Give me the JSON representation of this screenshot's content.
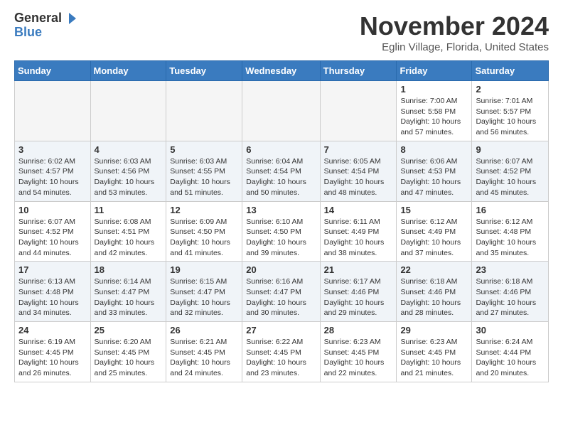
{
  "header": {
    "logo_line1": "General",
    "logo_line2": "Blue",
    "month": "November 2024",
    "location": "Eglin Village, Florida, United States"
  },
  "weekdays": [
    "Sunday",
    "Monday",
    "Tuesday",
    "Wednesday",
    "Thursday",
    "Friday",
    "Saturday"
  ],
  "weeks": [
    [
      {
        "day": "",
        "info": ""
      },
      {
        "day": "",
        "info": ""
      },
      {
        "day": "",
        "info": ""
      },
      {
        "day": "",
        "info": ""
      },
      {
        "day": "",
        "info": ""
      },
      {
        "day": "1",
        "info": "Sunrise: 7:00 AM\nSunset: 5:58 PM\nDaylight: 10 hours\nand 57 minutes."
      },
      {
        "day": "2",
        "info": "Sunrise: 7:01 AM\nSunset: 5:57 PM\nDaylight: 10 hours\nand 56 minutes."
      }
    ],
    [
      {
        "day": "3",
        "info": "Sunrise: 6:02 AM\nSunset: 4:57 PM\nDaylight: 10 hours\nand 54 minutes."
      },
      {
        "day": "4",
        "info": "Sunrise: 6:03 AM\nSunset: 4:56 PM\nDaylight: 10 hours\nand 53 minutes."
      },
      {
        "day": "5",
        "info": "Sunrise: 6:03 AM\nSunset: 4:55 PM\nDaylight: 10 hours\nand 51 minutes."
      },
      {
        "day": "6",
        "info": "Sunrise: 6:04 AM\nSunset: 4:54 PM\nDaylight: 10 hours\nand 50 minutes."
      },
      {
        "day": "7",
        "info": "Sunrise: 6:05 AM\nSunset: 4:54 PM\nDaylight: 10 hours\nand 48 minutes."
      },
      {
        "day": "8",
        "info": "Sunrise: 6:06 AM\nSunset: 4:53 PM\nDaylight: 10 hours\nand 47 minutes."
      },
      {
        "day": "9",
        "info": "Sunrise: 6:07 AM\nSunset: 4:52 PM\nDaylight: 10 hours\nand 45 minutes."
      }
    ],
    [
      {
        "day": "10",
        "info": "Sunrise: 6:07 AM\nSunset: 4:52 PM\nDaylight: 10 hours\nand 44 minutes."
      },
      {
        "day": "11",
        "info": "Sunrise: 6:08 AM\nSunset: 4:51 PM\nDaylight: 10 hours\nand 42 minutes."
      },
      {
        "day": "12",
        "info": "Sunrise: 6:09 AM\nSunset: 4:50 PM\nDaylight: 10 hours\nand 41 minutes."
      },
      {
        "day": "13",
        "info": "Sunrise: 6:10 AM\nSunset: 4:50 PM\nDaylight: 10 hours\nand 39 minutes."
      },
      {
        "day": "14",
        "info": "Sunrise: 6:11 AM\nSunset: 4:49 PM\nDaylight: 10 hours\nand 38 minutes."
      },
      {
        "day": "15",
        "info": "Sunrise: 6:12 AM\nSunset: 4:49 PM\nDaylight: 10 hours\nand 37 minutes."
      },
      {
        "day": "16",
        "info": "Sunrise: 6:12 AM\nSunset: 4:48 PM\nDaylight: 10 hours\nand 35 minutes."
      }
    ],
    [
      {
        "day": "17",
        "info": "Sunrise: 6:13 AM\nSunset: 4:48 PM\nDaylight: 10 hours\nand 34 minutes."
      },
      {
        "day": "18",
        "info": "Sunrise: 6:14 AM\nSunset: 4:47 PM\nDaylight: 10 hours\nand 33 minutes."
      },
      {
        "day": "19",
        "info": "Sunrise: 6:15 AM\nSunset: 4:47 PM\nDaylight: 10 hours\nand 32 minutes."
      },
      {
        "day": "20",
        "info": "Sunrise: 6:16 AM\nSunset: 4:47 PM\nDaylight: 10 hours\nand 30 minutes."
      },
      {
        "day": "21",
        "info": "Sunrise: 6:17 AM\nSunset: 4:46 PM\nDaylight: 10 hours\nand 29 minutes."
      },
      {
        "day": "22",
        "info": "Sunrise: 6:18 AM\nSunset: 4:46 PM\nDaylight: 10 hours\nand 28 minutes."
      },
      {
        "day": "23",
        "info": "Sunrise: 6:18 AM\nSunset: 4:46 PM\nDaylight: 10 hours\nand 27 minutes."
      }
    ],
    [
      {
        "day": "24",
        "info": "Sunrise: 6:19 AM\nSunset: 4:45 PM\nDaylight: 10 hours\nand 26 minutes."
      },
      {
        "day": "25",
        "info": "Sunrise: 6:20 AM\nSunset: 4:45 PM\nDaylight: 10 hours\nand 25 minutes."
      },
      {
        "day": "26",
        "info": "Sunrise: 6:21 AM\nSunset: 4:45 PM\nDaylight: 10 hours\nand 24 minutes."
      },
      {
        "day": "27",
        "info": "Sunrise: 6:22 AM\nSunset: 4:45 PM\nDaylight: 10 hours\nand 23 minutes."
      },
      {
        "day": "28",
        "info": "Sunrise: 6:23 AM\nSunset: 4:45 PM\nDaylight: 10 hours\nand 22 minutes."
      },
      {
        "day": "29",
        "info": "Sunrise: 6:23 AM\nSunset: 4:45 PM\nDaylight: 10 hours\nand 21 minutes."
      },
      {
        "day": "30",
        "info": "Sunrise: 6:24 AM\nSunset: 4:44 PM\nDaylight: 10 hours\nand 20 minutes."
      }
    ]
  ]
}
